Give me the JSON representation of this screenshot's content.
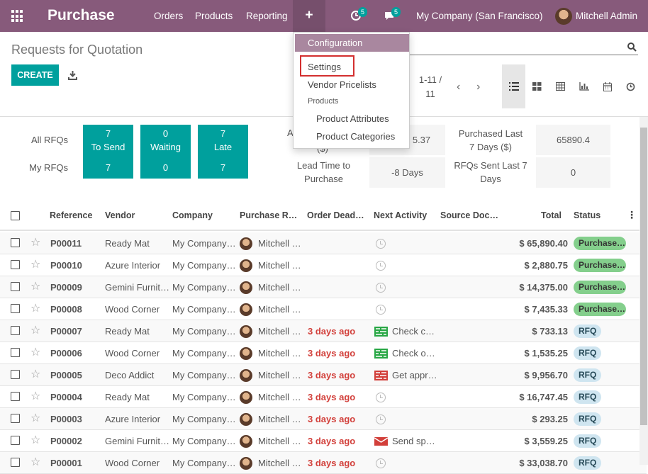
{
  "navbar": {
    "app_name": "Purchase",
    "menus": [
      "Orders",
      "Products",
      "Reporting"
    ],
    "activity_count": "5",
    "message_count": "5",
    "company": "My Company (San Francisco)",
    "user": "Mitchell Admin"
  },
  "dropdown": {
    "header": "Configuration",
    "items": [
      "Settings",
      "Vendor Pricelists"
    ],
    "section": "Products",
    "subitems": [
      "Product Attributes",
      "Product Categories"
    ]
  },
  "control_panel": {
    "breadcrumb": "Requests for Quotation",
    "create_label": "CREATE",
    "pager_line1": "1-11 /",
    "pager_line2": "11"
  },
  "dashboard": {
    "all_rfqs_label": "All RFQs",
    "my_rfqs_label": "My RFQs",
    "tiles": [
      {
        "value": "7",
        "label": "To Send",
        "mine": "7"
      },
      {
        "value": "0",
        "label": "Waiting",
        "mine": "0"
      },
      {
        "value": "7",
        "label": "Late",
        "mine": "7"
      }
    ],
    "stat_partial_label": "A",
    "stat_partial_label2": "($)",
    "stat_partial_value": "5.37",
    "lead_time_label_1": "Lead Time to",
    "lead_time_label_2": "Purchase",
    "lead_time_value": "-8  Days",
    "purchased_label_1": "Purchased Last",
    "purchased_label_2": "7 Days ($)",
    "purchased_value": "65890.4",
    "rfqs_sent_label_1": "RFQs Sent Last 7",
    "rfqs_sent_label_2": "Days",
    "rfqs_sent_value": "0"
  },
  "table": {
    "headers": [
      "Reference",
      "Vendor",
      "Company",
      "Purchase R…",
      "Order Dead…",
      "Next Activity",
      "Source Doc…",
      "Total",
      "Status"
    ],
    "rows": [
      {
        "ref": "P00011",
        "vendor": "Ready Mat",
        "company": "My Company…",
        "rep": "Mitchell …",
        "deadline": "",
        "activity": "",
        "total": "$ 65,890.40",
        "status": "Purchase…"
      },
      {
        "ref": "P00010",
        "vendor": "Azure Interior",
        "company": "My Company…",
        "rep": "Mitchell …",
        "deadline": "",
        "activity": "",
        "total": "$ 2,880.75",
        "status": "Purchase…"
      },
      {
        "ref": "P00009",
        "vendor": "Gemini Furnit…",
        "company": "My Company…",
        "rep": "Mitchell …",
        "deadline": "",
        "activity": "",
        "total": "$ 14,375.00",
        "status": "Purchase…"
      },
      {
        "ref": "P00008",
        "vendor": "Wood Corner",
        "company": "My Company…",
        "rep": "Mitchell …",
        "deadline": "",
        "activity": "",
        "total": "$ 7,435.33",
        "status": "Purchase…"
      },
      {
        "ref": "P00007",
        "vendor": "Ready Mat",
        "company": "My Company…",
        "rep": "Mitchell …",
        "deadline": "3 days ago",
        "activity": "Check c…",
        "total": "$ 733.13",
        "status": "RFQ"
      },
      {
        "ref": "P00006",
        "vendor": "Wood Corner",
        "company": "My Company…",
        "rep": "Mitchell …",
        "deadline": "3 days ago",
        "activity": "Check o…",
        "total": "$ 1,535.25",
        "status": "RFQ"
      },
      {
        "ref": "P00005",
        "vendor": "Deco Addict",
        "company": "My Company…",
        "rep": "Mitchell …",
        "deadline": "3 days ago",
        "activity": "Get appr…",
        "total": "$ 9,956.70",
        "status": "RFQ"
      },
      {
        "ref": "P00004",
        "vendor": "Ready Mat",
        "company": "My Company…",
        "rep": "Mitchell …",
        "deadline": "3 days ago",
        "activity": "",
        "total": "$ 16,747.45",
        "status": "RFQ"
      },
      {
        "ref": "P00003",
        "vendor": "Azure Interior",
        "company": "My Company…",
        "rep": "Mitchell …",
        "deadline": "3 days ago",
        "activity": "",
        "total": "$ 293.25",
        "status": "RFQ"
      },
      {
        "ref": "P00002",
        "vendor": "Gemini Furnit…",
        "company": "My Company…",
        "rep": "Mitchell …",
        "deadline": "3 days ago",
        "activity": "Send sp…",
        "total": "$ 3,559.25",
        "status": "RFQ"
      },
      {
        "ref": "P00001",
        "vendor": "Wood Corner",
        "company": "My Company…",
        "rep": "Mitchell …",
        "deadline": "3 days ago",
        "activity": "",
        "total": "$ 33,038.70",
        "status": "RFQ"
      }
    ]
  }
}
